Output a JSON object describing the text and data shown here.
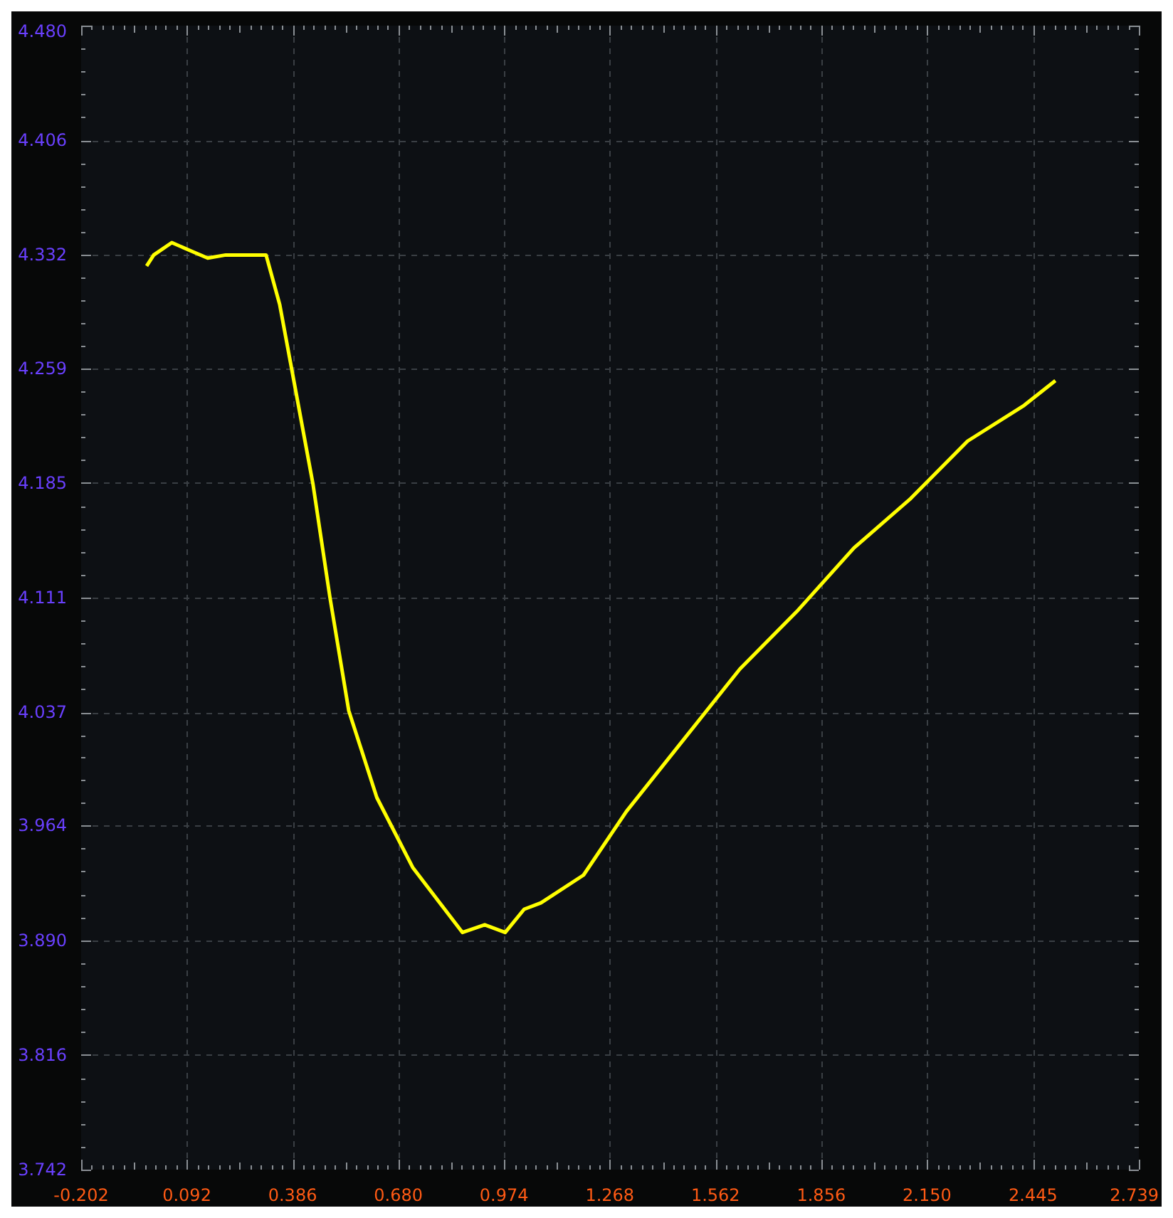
{
  "plot": {
    "chart_data": {
      "type": "line",
      "grid": true,
      "x": [
        -0.02,
        0.0,
        0.05,
        0.1,
        0.15,
        0.2,
        0.25,
        0.312,
        0.35,
        0.384,
        0.443,
        0.49,
        0.542,
        0.62,
        0.72,
        0.858,
        0.92,
        0.977,
        1.03,
        1.076,
        1.195,
        1.314,
        1.472,
        1.63,
        1.788,
        1.947,
        2.105,
        2.263,
        2.42,
        2.507
      ],
      "series": [
        {
          "color": "#ffff00",
          "values": [
            4.325,
            4.332,
            4.34,
            4.335,
            4.33,
            4.332,
            4.332,
            4.332,
            4.3,
            4.258,
            4.184,
            4.111,
            4.038,
            3.982,
            3.937,
            3.895,
            3.9,
            3.895,
            3.91,
            3.914,
            3.932,
            3.973,
            4.019,
            4.065,
            4.102,
            4.143,
            4.175,
            4.212,
            4.235,
            4.251
          ]
        }
      ],
      "xlim": [
        -0.202,
        2.739
      ],
      "ylim": [
        3.742,
        4.48
      ],
      "xticks": [
        {
          "value": -0.202,
          "label": "-0.202"
        },
        {
          "value": 0.092,
          "label": "0.092"
        },
        {
          "value": 0.386,
          "label": "0.386"
        },
        {
          "value": 0.68,
          "label": "0.680"
        },
        {
          "value": 0.974,
          "label": "0.974"
        },
        {
          "value": 1.268,
          "label": "1.268"
        },
        {
          "value": 1.562,
          "label": "1.562"
        },
        {
          "value": 1.856,
          "label": "1.856"
        },
        {
          "value": 2.15,
          "label": "2.150"
        },
        {
          "value": 2.445,
          "label": "2.445"
        },
        {
          "value": 2.739,
          "label": "2.739"
        }
      ],
      "yticks": [
        {
          "value": 3.742,
          "label": "3.742"
        },
        {
          "value": 3.816,
          "label": "3.816"
        },
        {
          "value": 3.89,
          "label": "3.890"
        },
        {
          "value": 3.964,
          "label": "3.964"
        },
        {
          "value": 4.037,
          "label": "4.037"
        },
        {
          "value": 4.111,
          "label": "4.111"
        },
        {
          "value": 4.185,
          "label": "4.185"
        },
        {
          "value": 4.259,
          "label": "4.259"
        },
        {
          "value": 4.332,
          "label": "4.332"
        },
        {
          "value": 4.406,
          "label": "4.406"
        },
        {
          "value": 4.48,
          "label": "4.480"
        }
      ]
    }
  }
}
